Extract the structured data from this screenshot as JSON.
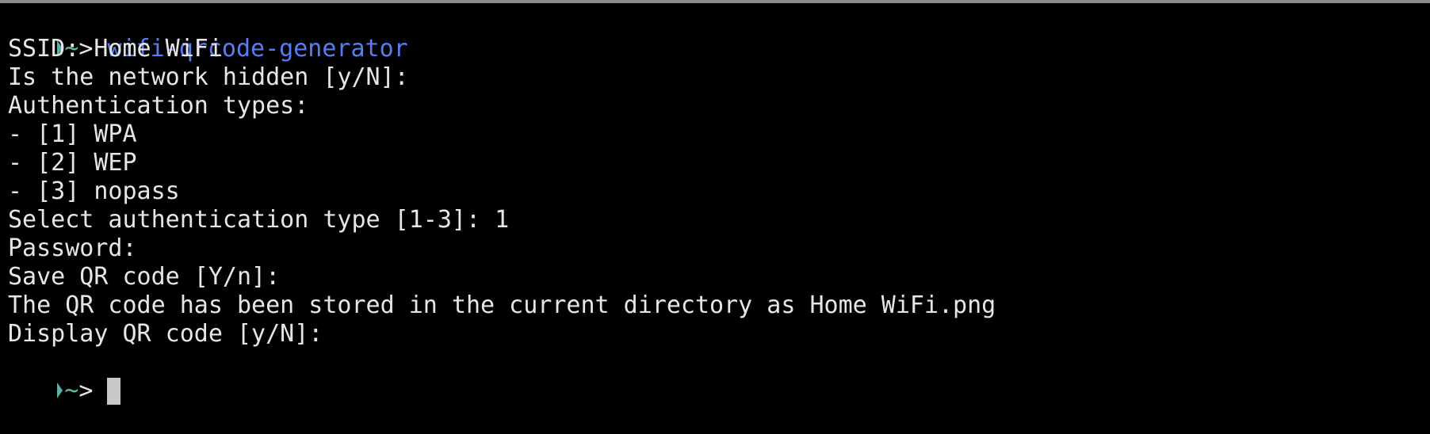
{
  "prompt": {
    "tilde": "~",
    "gt": "> "
  },
  "command": "wifi-qrcode-generator",
  "output_lines": [
    "SSID: Home WiFi",
    "Is the network hidden [y/N]:",
    "Authentication types:",
    "- [1] WPA",
    "- [2] WEP",
    "- [3] nopass",
    "Select authentication type [1-3]: 1",
    "Password:",
    "Save QR code [Y/n]:",
    "The QR code has been stored in the current directory as Home WiFi.png",
    "Display QR code [y/N]:"
  ],
  "colors": {
    "background": "#000000",
    "text": "#e6e6e6",
    "command": "#5b7cf0",
    "prompt_tilde": "#5fbf8f",
    "prompt_arrow": "#5fafa8",
    "cursor": "#c8c8c8"
  }
}
